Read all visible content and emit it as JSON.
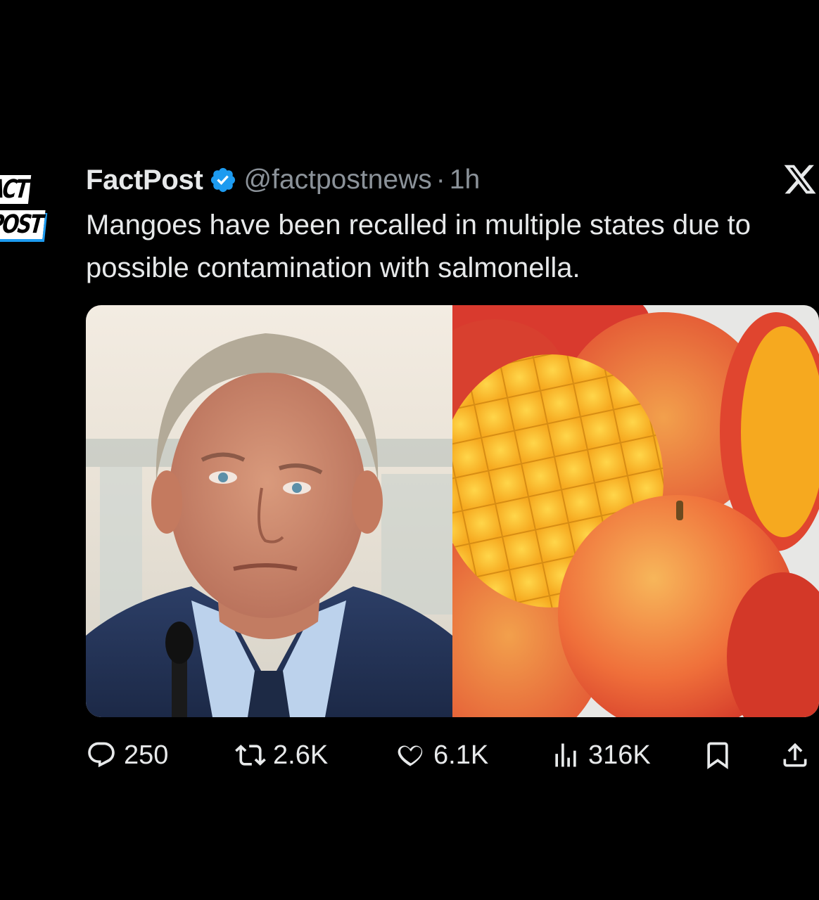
{
  "tweet": {
    "display_name": "FactPost",
    "handle": "@factpostnews",
    "separator": "·",
    "time": "1h",
    "text": "Mangoes have been recalled in multiple states due to possible contamination with salmonella.",
    "verified_icon": "verified-badge-icon",
    "platform_icon": "x-logo-icon"
  },
  "avatar": {
    "line1": "ACT",
    "line2": "POST"
  },
  "media": {
    "left_image": "photo-man-in-suit",
    "right_image": "photo-mangoes"
  },
  "actions": {
    "replies": "250",
    "reposts": "2.6K",
    "likes": "6.1K",
    "views": "316K",
    "icons": [
      "reply-icon",
      "repost-icon",
      "like-icon",
      "views-icon",
      "bookmark-icon",
      "share-icon"
    ]
  },
  "colors": {
    "background": "#000000",
    "text": "#e7e9ea",
    "secondary_text": "#8b9299",
    "verified_blue": "#1d9bf0"
  }
}
